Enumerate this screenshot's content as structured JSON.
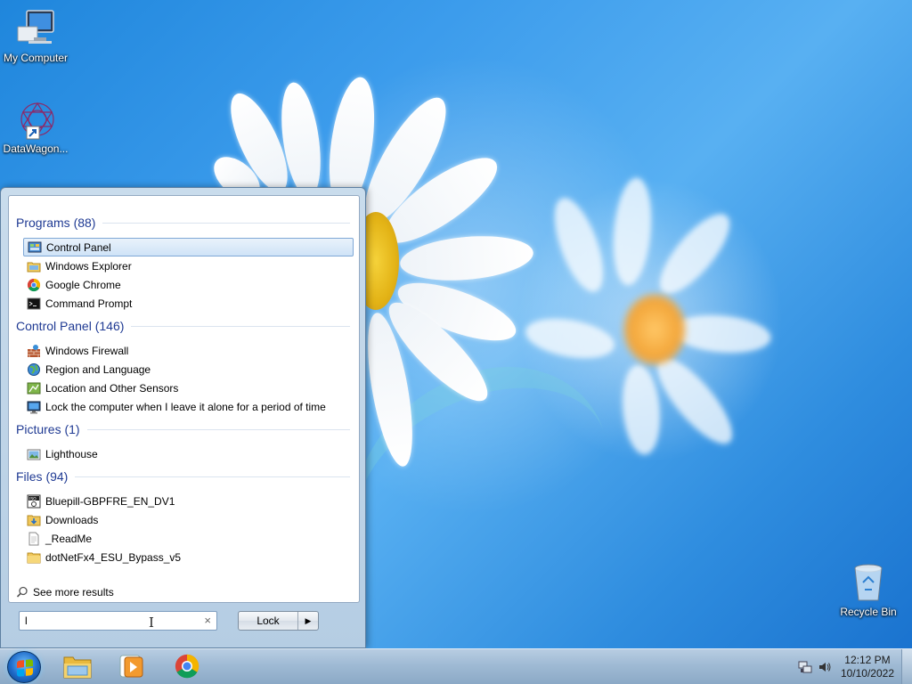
{
  "desktop": {
    "icons": [
      {
        "label": "My Computer",
        "icon": "computer-icon"
      },
      {
        "label": "DataWagon...",
        "icon": "datawagon-shortcut-icon"
      },
      {
        "label": "Recycle Bin",
        "icon": "recycle-bin-icon"
      }
    ]
  },
  "start_menu": {
    "groups": [
      {
        "title": "Programs (88)",
        "items": [
          {
            "label": "Control Panel",
            "icon": "control-panel-icon",
            "selected": true
          },
          {
            "label": "Windows Explorer",
            "icon": "windows-explorer-icon"
          },
          {
            "label": "Google Chrome",
            "icon": "chrome-icon"
          },
          {
            "label": "Command Prompt",
            "icon": "command-prompt-icon"
          }
        ]
      },
      {
        "title": "Control Panel (146)",
        "items": [
          {
            "label": "Windows Firewall",
            "icon": "firewall-icon"
          },
          {
            "label": "Region and Language",
            "icon": "globe-icon"
          },
          {
            "label": "Location and Other Sensors",
            "icon": "sensors-icon"
          },
          {
            "label": "Lock the computer when I leave it alone for a period of time",
            "icon": "monitor-icon"
          }
        ]
      },
      {
        "title": "Pictures (1)",
        "items": [
          {
            "label": "Lighthouse",
            "icon": "picture-icon"
          }
        ]
      },
      {
        "title": "Files (94)",
        "items": [
          {
            "label": "Bluepill-GBPFRE_EN_DV1",
            "icon": "iso-file-icon"
          },
          {
            "label": "Downloads",
            "icon": "downloads-folder-icon"
          },
          {
            "label": "_ReadMe",
            "icon": "text-file-icon"
          },
          {
            "label": "dotNetFx4_ESU_Bypass_v5",
            "icon": "folder-icon"
          }
        ]
      }
    ],
    "see_more": "See more results",
    "search": {
      "value": "l",
      "clear": "×"
    },
    "lock_button": {
      "label": "Lock",
      "arrow": "▶"
    }
  },
  "taskbar": {
    "pinned": [
      "windows-explorer-icon",
      "media-player-icon",
      "chrome-icon"
    ],
    "clock": {
      "time": "12:12 PM",
      "date": "10/10/2022"
    }
  }
}
